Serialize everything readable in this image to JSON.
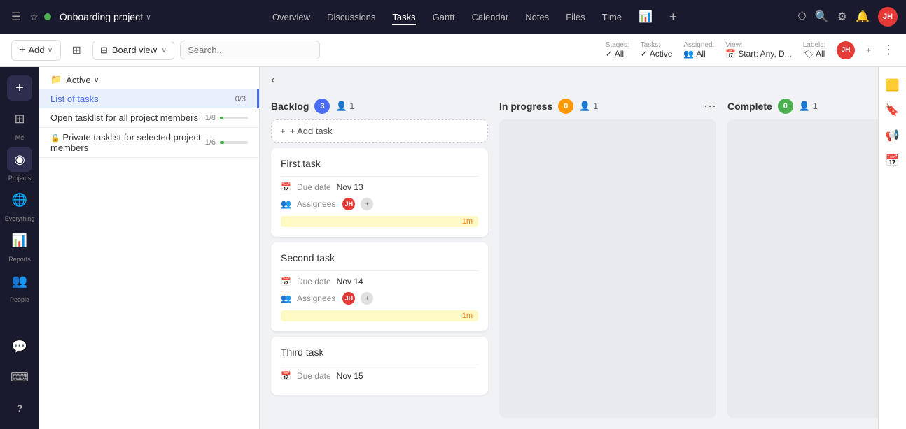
{
  "topnav": {
    "hamburger_label": "☰",
    "star_label": "☆",
    "project_name": "Onboarding project",
    "project_chevron": "∨",
    "nav_items": [
      {
        "label": "Overview",
        "active": false
      },
      {
        "label": "Discussions",
        "active": false
      },
      {
        "label": "Tasks",
        "active": true
      },
      {
        "label": "Gantt",
        "active": false
      },
      {
        "label": "Calendar",
        "active": false
      },
      {
        "label": "Notes",
        "active": false
      },
      {
        "label": "Files",
        "active": false
      },
      {
        "label": "Time",
        "active": false
      }
    ],
    "chart_icon": "📊",
    "plus_icon": "+",
    "clock_icon": "🕐",
    "search_icon": "🔍",
    "gear_icon": "⚙",
    "bell_icon": "🔔",
    "avatar_initials": "JH"
  },
  "toolbar": {
    "add_label": "Add",
    "view_label": "Board view",
    "search_placeholder": "Search...",
    "stages_label": "Stages:",
    "stages_value": "All",
    "tasks_label": "Tasks:",
    "tasks_value": "Active",
    "assigned_label": "Assigned:",
    "assigned_value": "All",
    "view_label2": "View:",
    "view_value": "Start: Any, D...",
    "labels_label": "Labels:",
    "labels_value": "All",
    "avatar_initials": "JH"
  },
  "sidebar": {
    "items": [
      {
        "icon": "⊞",
        "label": "Me",
        "active": false
      },
      {
        "icon": "◉",
        "label": "Projects",
        "active": true
      },
      {
        "icon": "🌐",
        "label": "Everything",
        "active": false
      },
      {
        "icon": "📊",
        "label": "Reports",
        "active": false
      },
      {
        "icon": "👥",
        "label": "People",
        "active": false
      },
      {
        "icon": "💬",
        "label": "",
        "active": false
      },
      {
        "icon": "⌨",
        "label": "",
        "active": false
      },
      {
        "icon": "?",
        "label": "",
        "active": false
      }
    ]
  },
  "left_panel": {
    "folder_icon": "📁",
    "active_label": "Active",
    "active_chevron": "∨",
    "task_lists": [
      {
        "name": "List of tasks",
        "count": "0/3",
        "selected": true,
        "progress": 0
      },
      {
        "name": "Open tasklist for all project members",
        "count": "1/8",
        "selected": false,
        "progress": 12,
        "lock": false
      },
      {
        "name": "Private tasklist for selected project members",
        "count": "1/6",
        "selected": false,
        "progress": 16,
        "lock": true
      }
    ]
  },
  "board": {
    "collapse_icon": "‹",
    "columns": [
      {
        "title": "Backlog",
        "count": "3",
        "badge_color": "blue",
        "assignee_icon": "👤",
        "assignee_count": "1",
        "show_more": false,
        "tasks": [
          {
            "title": "First task",
            "due_label": "Due date",
            "due_value": "Nov 13",
            "assignees_label": "Assignees",
            "avatar_initials": "JH",
            "time_badge": "1m"
          },
          {
            "title": "Second task",
            "due_label": "Due date",
            "due_value": "Nov 14",
            "assignees_label": "Assignees",
            "avatar_initials": "JH",
            "time_badge": "1m"
          },
          {
            "title": "Third task",
            "due_label": "Due date",
            "due_value": "Nov 15",
            "assignees_label": "",
            "avatar_initials": "",
            "time_badge": ""
          }
        ]
      },
      {
        "title": "In progress",
        "count": "0",
        "badge_color": "orange",
        "assignee_icon": "👤",
        "assignee_count": "1",
        "show_more": true,
        "tasks": []
      },
      {
        "title": "Complete",
        "count": "0",
        "badge_color": "green",
        "assignee_icon": "👤",
        "assignee_count": "1",
        "show_more": false,
        "tasks": []
      }
    ],
    "add_task_label": "+ Add task"
  },
  "right_toolbar": {
    "icons": [
      {
        "icon": "🟨",
        "name": "yellow-square"
      },
      {
        "icon": "🔖",
        "name": "bookmark"
      },
      {
        "icon": "📢",
        "name": "megaphone"
      },
      {
        "icon": "📅",
        "name": "calendar-right"
      }
    ]
  }
}
